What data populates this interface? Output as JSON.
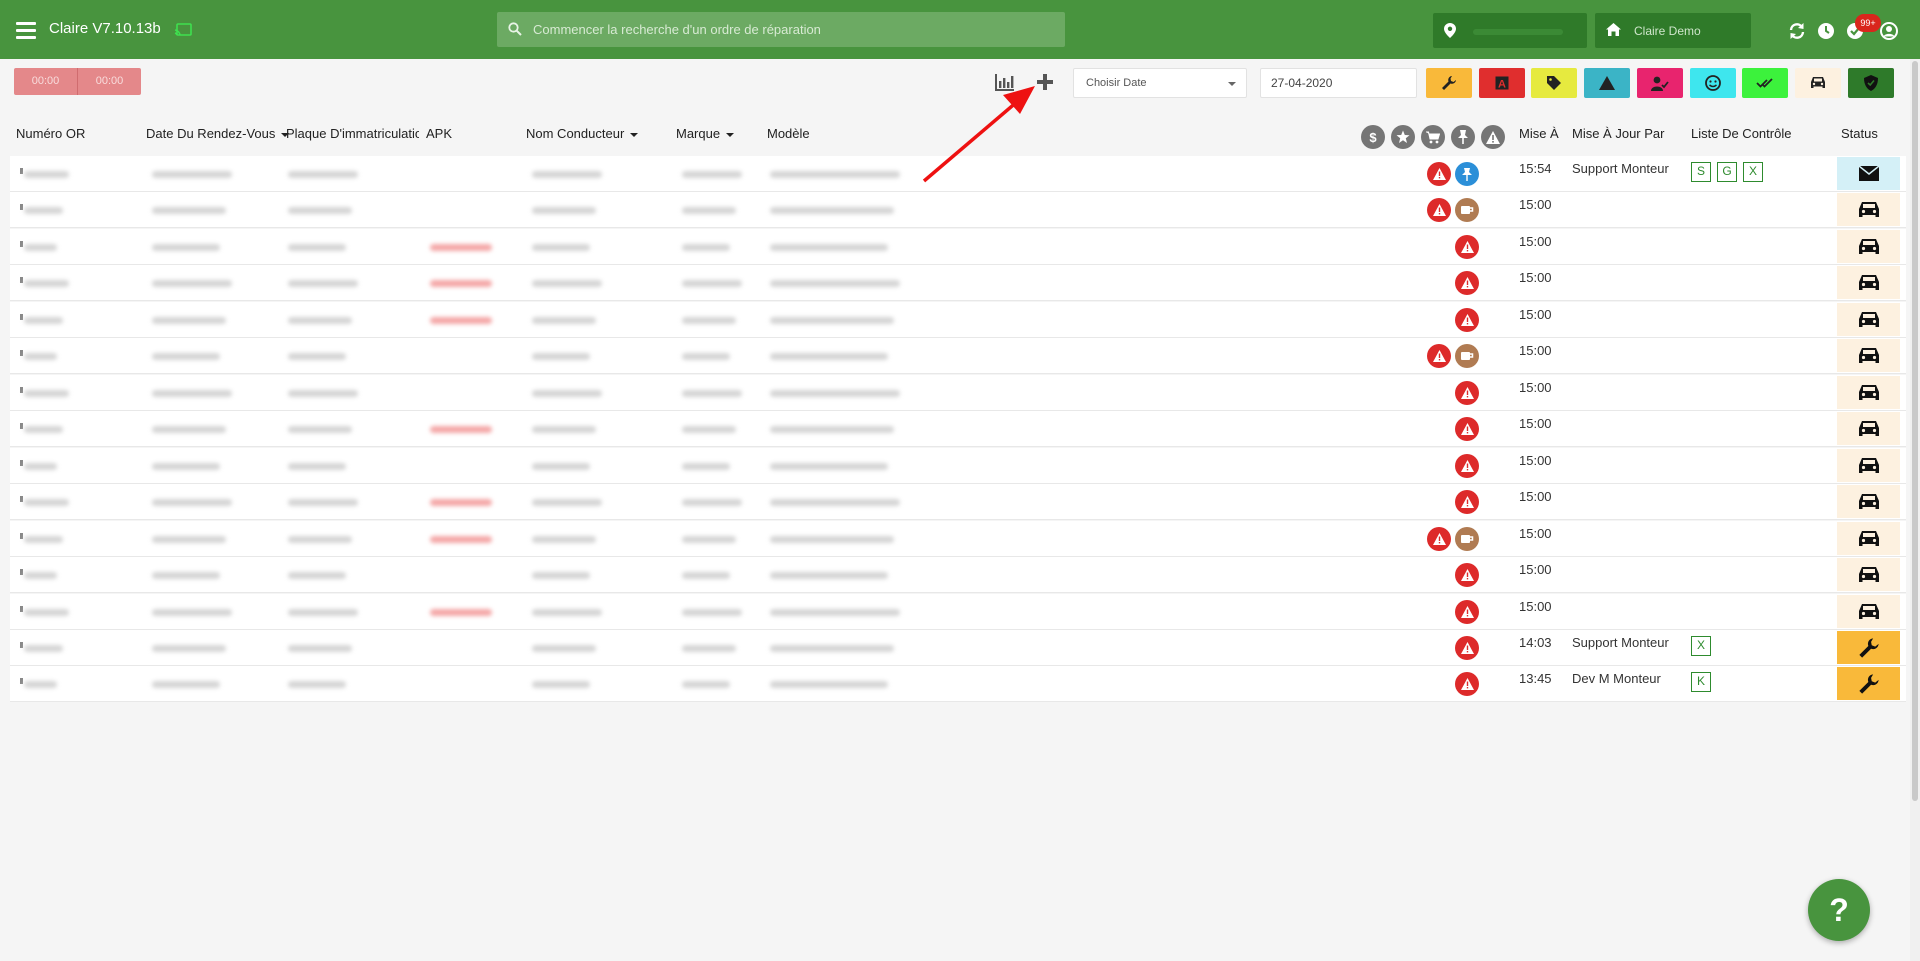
{
  "header": {
    "app_title": "Claire V7.10.13b",
    "search_placeholder": "Commencer la recherche d'un ordre de réparation",
    "location_label": "Claire Demo",
    "notification_count": "99+"
  },
  "toolbar": {
    "timer_left": "00:00",
    "timer_right": "00:00",
    "date_select_value": "Choisir Date",
    "date_value": "27-04-2020",
    "filter_buttons": [
      {
        "name": "wrench",
        "color": "#f9b93a"
      },
      {
        "name": "letter-a",
        "color": "#e02e2e"
      },
      {
        "name": "tag",
        "color": "#e6ea3f"
      },
      {
        "name": "warning",
        "color": "#3bb4c6"
      },
      {
        "name": "user-check",
        "color": "#e8246e"
      },
      {
        "name": "face",
        "color": "#3ee6ee"
      },
      {
        "name": "double-check",
        "color": "#3cf23c"
      },
      {
        "name": "car",
        "color": "#fdf1e0"
      },
      {
        "name": "shield",
        "color": "#2e7a2a"
      }
    ]
  },
  "table": {
    "columns": {
      "numero_or": "Numéro OR",
      "date_rdv": "Date Du Rendez-Vous",
      "plaque": "Plaque D'immatriculatio",
      "apk": "APK",
      "nom_conducteur": "Nom Conducteur",
      "marque": "Marque",
      "modele": "Modèle",
      "mise_a": "Mise À",
      "mise_a_jour_par": "Mise À Jour Par",
      "liste_controle": "Liste De Contrôle",
      "status": "Status"
    },
    "rows": [
      {
        "icons": [
          "alert",
          "pin"
        ],
        "time": "15:54",
        "updated_by": "Support Monteur",
        "checks": [
          "S",
          "G",
          "X"
        ],
        "status": "mail",
        "apk_red": false
      },
      {
        "icons": [
          "alert",
          "coffee"
        ],
        "time": "15:00",
        "updated_by": "",
        "checks": [],
        "status": "car",
        "apk_red": false
      },
      {
        "icons": [
          "alert"
        ],
        "time": "15:00",
        "updated_by": "",
        "checks": [],
        "status": "car",
        "apk_red": true
      },
      {
        "icons": [
          "alert"
        ],
        "time": "15:00",
        "updated_by": "",
        "checks": [],
        "status": "car",
        "apk_red": true
      },
      {
        "icons": [
          "alert"
        ],
        "time": "15:00",
        "updated_by": "",
        "checks": [],
        "status": "car",
        "apk_red": true
      },
      {
        "icons": [
          "alert",
          "coffee"
        ],
        "time": "15:00",
        "updated_by": "",
        "checks": [],
        "status": "car",
        "apk_red": false
      },
      {
        "icons": [
          "alert"
        ],
        "time": "15:00",
        "updated_by": "",
        "checks": [],
        "status": "car",
        "apk_red": false
      },
      {
        "icons": [
          "alert"
        ],
        "time": "15:00",
        "updated_by": "",
        "checks": [],
        "status": "car",
        "apk_red": true
      },
      {
        "icons": [
          "alert"
        ],
        "time": "15:00",
        "updated_by": "",
        "checks": [],
        "status": "car",
        "apk_red": false
      },
      {
        "icons": [
          "alert"
        ],
        "time": "15:00",
        "updated_by": "",
        "checks": [],
        "status": "car",
        "apk_red": true
      },
      {
        "icons": [
          "alert",
          "coffee"
        ],
        "time": "15:00",
        "updated_by": "",
        "checks": [],
        "status": "car",
        "apk_red": true
      },
      {
        "icons": [
          "alert"
        ],
        "time": "15:00",
        "updated_by": "",
        "checks": [],
        "status": "car",
        "apk_red": false
      },
      {
        "icons": [
          "alert"
        ],
        "time": "15:00",
        "updated_by": "",
        "checks": [],
        "status": "car",
        "apk_red": true
      },
      {
        "icons": [
          "alert"
        ],
        "time": "14:03",
        "updated_by": "Support Monteur",
        "checks": [
          "X"
        ],
        "status": "wrench",
        "apk_red": false
      },
      {
        "icons": [
          "alert"
        ],
        "time": "13:45",
        "updated_by": "Dev M Monteur",
        "checks": [
          "K"
        ],
        "status": "wrench",
        "apk_red": false
      }
    ]
  },
  "help_label": "?"
}
